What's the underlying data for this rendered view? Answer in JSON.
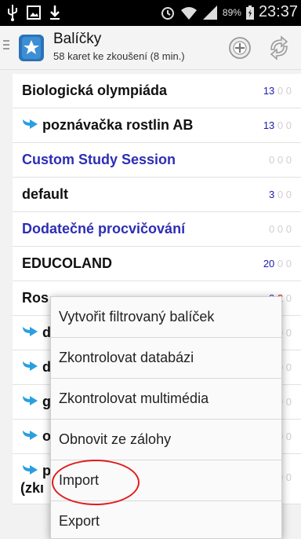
{
  "status_bar": {
    "battery": "89%",
    "time": "23:37"
  },
  "app": {
    "title": "Balíčky",
    "subtitle": "58 karet ke zkoušení (8 min.)"
  },
  "decks": [
    {
      "name": "Biologická olympiáda",
      "new": "13",
      "lrn": "0",
      "rev": "0",
      "filtered": false,
      "subdeck": false
    },
    {
      "name": "poznávačka rostlin AB",
      "new": "13",
      "lrn": "0",
      "rev": "0",
      "filtered": false,
      "subdeck": true
    },
    {
      "name": "Custom Study Session",
      "new": "0",
      "lrn": "0",
      "rev": "0",
      "filtered": true,
      "subdeck": false
    },
    {
      "name": "default",
      "new": "3",
      "lrn": "0",
      "rev": "0",
      "filtered": false,
      "subdeck": false
    },
    {
      "name": "Dodatečné procvičování",
      "new": "0",
      "lrn": "0",
      "rev": "0",
      "filtered": true,
      "subdeck": false
    },
    {
      "name": "EDUCOLAND",
      "new": "20",
      "lrn": "0",
      "rev": "0",
      "filtered": false,
      "subdeck": false
    },
    {
      "name": "Ros",
      "new": "0",
      "lrn": "2",
      "rev": "0",
      "filtered": false,
      "subdeck": false
    },
    {
      "name": "d",
      "new": "0",
      "lrn": "0",
      "rev": "0",
      "filtered": false,
      "subdeck": true
    },
    {
      "name": "d",
      "new": "0",
      "lrn": "0",
      "rev": "0",
      "filtered": false,
      "subdeck": true
    },
    {
      "name": "g",
      "new": "0",
      "lrn": "0",
      "rev": "0",
      "filtered": false,
      "subdeck": true
    },
    {
      "name": "o",
      "new": "0",
      "lrn": "0",
      "rev": "0",
      "filtered": false,
      "subdeck": true
    },
    {
      "name": "p",
      "name2": "(zkı",
      "new": "0",
      "lrn": "0",
      "rev": "0",
      "filtered": false,
      "subdeck": true
    }
  ],
  "menu": {
    "items": [
      "Vytvořit filtrovaný balíček",
      "Zkontrolovat databázi",
      "Zkontrolovat multimédia",
      "Obnovit ze zálohy",
      "Import",
      "Export"
    ]
  },
  "colors": {
    "new": "#1a1ab0",
    "learning": "#cc1111",
    "review": "#cfcfcf",
    "filtered": "#2d2db5",
    "highlight": "#e31b1b"
  }
}
